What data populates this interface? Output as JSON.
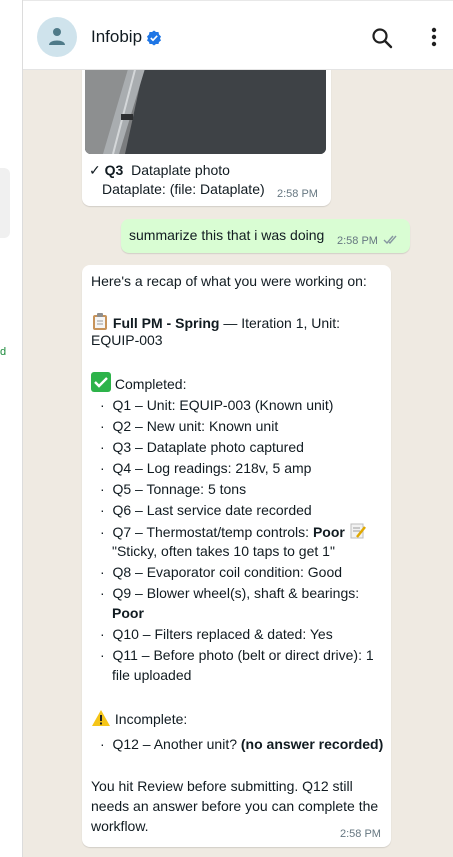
{
  "sidebar": {
    "partial_text": "d"
  },
  "header": {
    "name": "Infobip"
  },
  "photo_message": {
    "check": "✓",
    "question": "Q3",
    "title": "Dataplate photo",
    "detail": "Dataplate: (file: Dataplate)",
    "time": "2:58 PM"
  },
  "outgoing_message": {
    "text": "summarize this that i was doing",
    "time": "2:58 PM"
  },
  "recap_message": {
    "intro": "Here's a recap of what you were working on:",
    "job_title": "Full PM - Spring",
    "job_rest": " — Iteration 1, Unit:",
    "job_line2": "EQUIP-003",
    "completed_label": "Completed:",
    "items": [
      "Q1 – Unit: EQUIP-003 (Known unit)",
      "Q2 – New unit: Known unit",
      "Q3 – Dataplate photo captured",
      "Q4 – Log readings: 218v, 5 amp",
      "Q5 – Tonnage: 5 tons",
      "Q6 – Last service date recorded"
    ],
    "q7_prefix": "Q7 – Thermostat/temp controls: ",
    "q7_bold": "Poor",
    "q7_quote": "\"Sticky, often takes 10 taps to get 1\"",
    "q8": "Q8 – Evaporator coil condition: Good",
    "q9_line1": "Q9 – Blower wheel(s), shaft & bearings:",
    "q9_bold": "Poor",
    "q10": "Q10 – Filters replaced & dated: Yes",
    "q11_line1": "Q11 – Before photo (belt or direct drive): 1",
    "q11_line2": "file uploaded",
    "incomplete_label": "Incomplete:",
    "q12_prefix": "Q12 – Another unit? ",
    "q12_bold": "(no answer recorded)",
    "footer_line1": "You hit Review before submitting. Q12 still",
    "footer_line2": "needs an answer before you can complete the",
    "footer_line3": "workflow.",
    "time": "2:58 PM"
  },
  "colors": {
    "chat_background": "#efeae2",
    "incoming_bubble": "#ffffff",
    "outgoing_bubble": "#d9fdd3",
    "verified_badge": "#1f76e5",
    "completed_check": "#2db34a",
    "warning": "#f5c518"
  },
  "icons": [
    "person-icon",
    "verified-badge-icon",
    "search-icon",
    "more-vertical-icon",
    "clipboard-icon",
    "check-mark-icon",
    "memo-icon",
    "warning-icon",
    "double-check-icon"
  ]
}
